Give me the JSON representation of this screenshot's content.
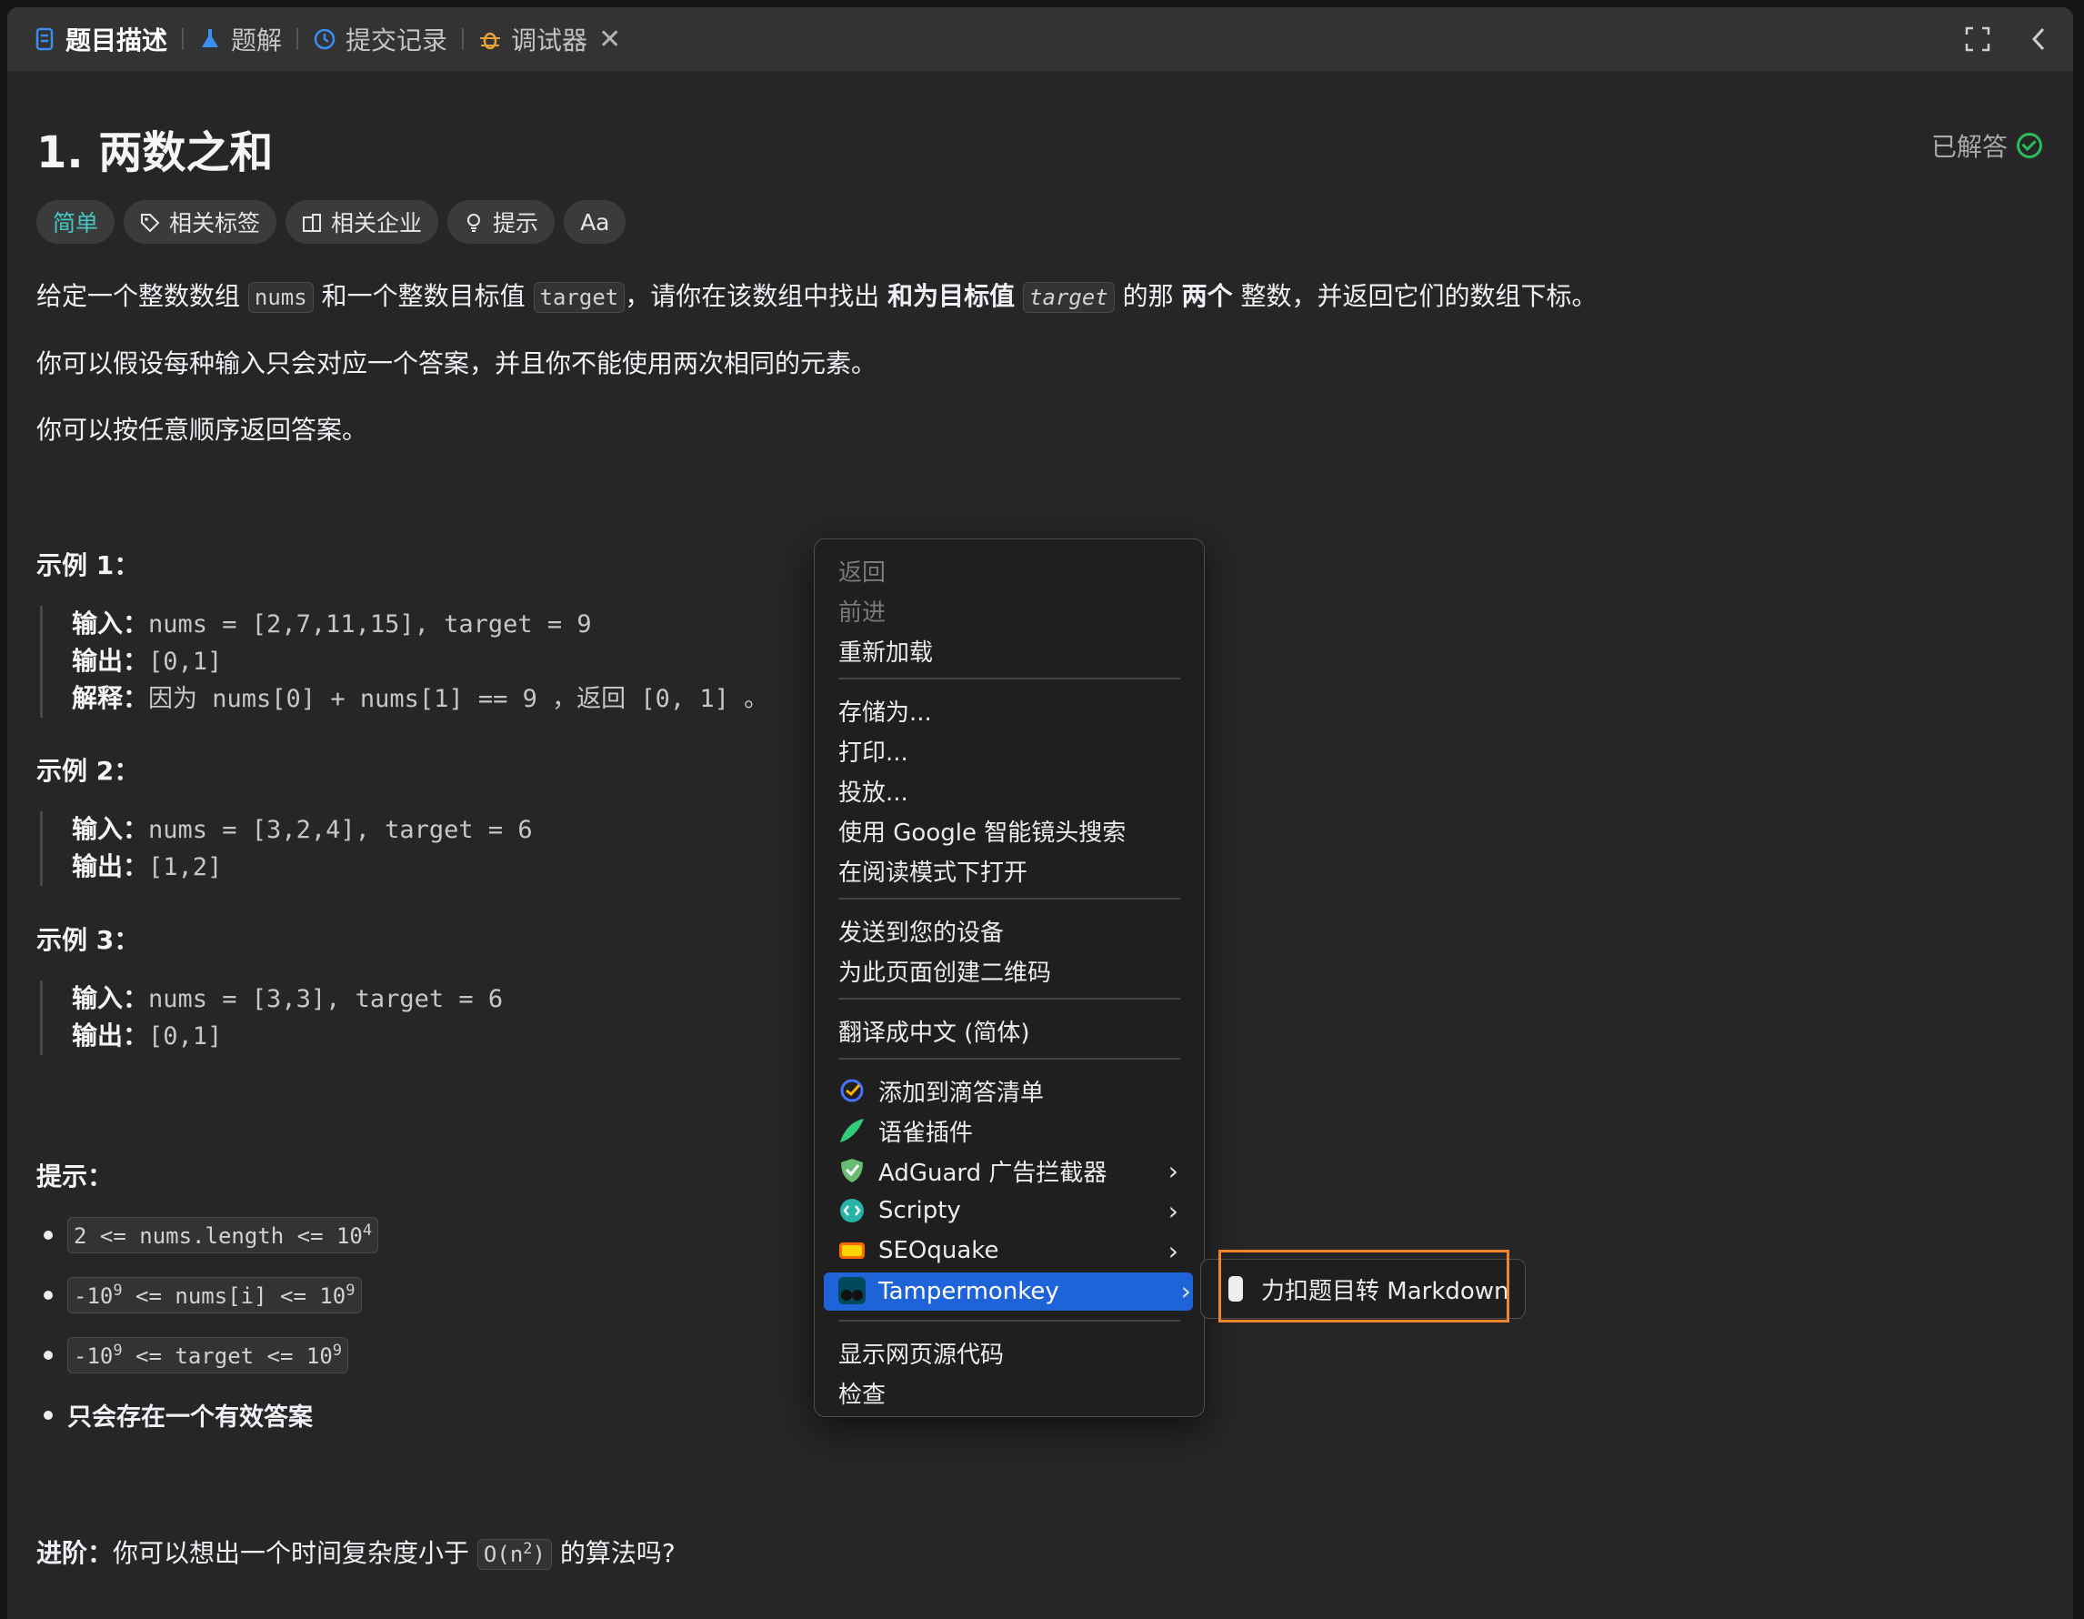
{
  "tabs": [
    {
      "label": "题目描述",
      "icon": "document-icon",
      "active": true
    },
    {
      "label": "题解",
      "icon": "flask-icon"
    },
    {
      "label": "提交记录",
      "icon": "history-icon"
    },
    {
      "label": "调试器",
      "icon": "bug-icon",
      "closable": true
    }
  ],
  "tab_close": "✕",
  "problem": {
    "title": "1. 两数之和",
    "status": "已解答",
    "tags": [
      "简单",
      "相关标签",
      "相关企业",
      "提示",
      "Aa"
    ],
    "desc1": {
      "p1": "给定一个整数数组 ",
      "c1": "nums",
      "p2": " 和一个整数目标值 ",
      "c2": "target",
      "p3": "，请你在该数组中找出 ",
      "b1": "和为目标值",
      "p4": " ",
      "c3": "target",
      "p5": " 的那 ",
      "b2": "两个",
      "p6": " 整数，并返回它们的数组下标。"
    },
    "desc2": "你可以假设每种输入只会对应一个答案，并且你不能使用两次相同的元素。",
    "desc3": "你可以按任意顺序返回答案。",
    "examples": [
      {
        "title": "示例 1：",
        "input_label": "输入：",
        "input": "nums = [2,7,11,15], target = 9",
        "output_label": "输出：",
        "output": "[0,1]",
        "explain_label": "解释：",
        "explain": "因为 nums[0] + nums[1] == 9 ，返回 [0, 1] 。"
      },
      {
        "title": "示例 2：",
        "input_label": "输入：",
        "input": "nums = [3,2,4], target = 6",
        "output_label": "输出：",
        "output": "[1,2]"
      },
      {
        "title": "示例 3：",
        "input_label": "输入：",
        "input": "nums = [3,3], target = 6",
        "output_label": "输出：",
        "output": "[0,1]"
      }
    ],
    "hints_title": "提示：",
    "constraints": [
      {
        "pre": "2 <= nums.length <= 10",
        "sup": "4"
      },
      {
        "pre": "-10",
        "sup1": "9",
        "mid": " <= nums[i] <= 10",
        "sup": "9"
      },
      {
        "pre": "-10",
        "sup1": "9",
        "mid": " <= target <= 10",
        "sup": "9"
      }
    ],
    "constraint_bold": "只会存在一个有效答案",
    "advanced_label": "进阶：",
    "advanced_text": "你可以想出一个时间复杂度小于 ",
    "advanced_code_pre": "O(n",
    "advanced_code_sup": "2",
    "advanced_code_post": ")",
    "advanced_tail": " 的算法吗?"
  },
  "context_menu": {
    "items": [
      {
        "label": "返回",
        "disabled": true
      },
      {
        "label": "前进",
        "disabled": true
      },
      {
        "label": "重新加载"
      },
      {
        "label": "存储为..."
      },
      {
        "label": "打印..."
      },
      {
        "label": "投放..."
      },
      {
        "label": "使用 Google 智能镜头搜索"
      },
      {
        "label": "在阅读模式下打开"
      },
      {
        "label": "发送到您的设备"
      },
      {
        "label": "为此页面创建二维码"
      },
      {
        "label": "翻译成中文 (简体)"
      },
      {
        "label": "添加到滴答清单",
        "icon": "ticktick-icon"
      },
      {
        "label": "语雀插件",
        "icon": "yuque-icon"
      },
      {
        "label": "AdGuard 广告拦截器",
        "icon": "adguard-shield-icon",
        "submenu": true
      },
      {
        "label": "Scripty",
        "icon": "scripty-icon",
        "submenu": true
      },
      {
        "label": "SEOquake",
        "icon": "seoquake-icon",
        "submenu": true
      },
      {
        "label": "Tampermonkey",
        "icon": "tampermonkey-icon",
        "submenu": true,
        "highlighted": true
      },
      {
        "label": "显示网页源代码"
      },
      {
        "label": "检查"
      }
    ],
    "arrow": "›"
  },
  "submenu": {
    "label": "力扣题目转 Markdown",
    "icon": "userscript-icon"
  },
  "colors": {
    "accent_easy": "#46c6c2",
    "highlight": "#1f63d8",
    "outline": "#f0852d",
    "solved": "#2cbb5d"
  }
}
